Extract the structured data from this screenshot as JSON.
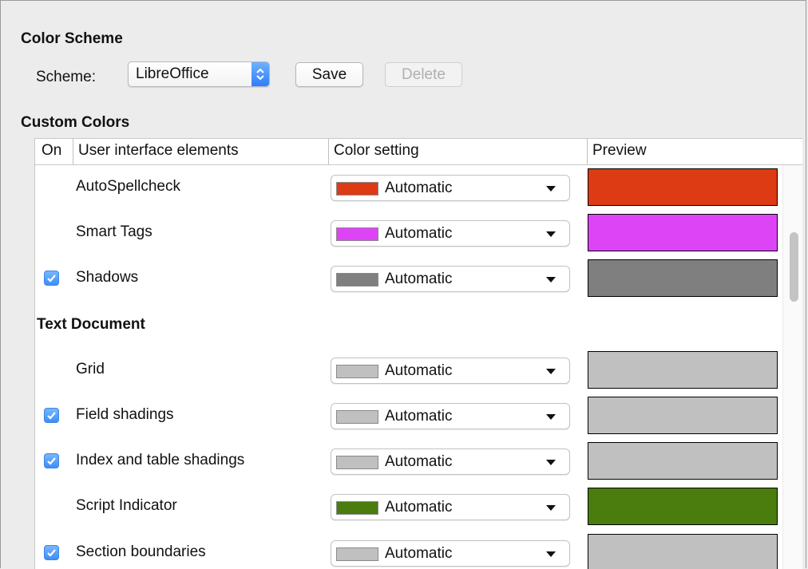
{
  "color_scheme": {
    "title": "Color Scheme",
    "scheme_label": "Scheme:",
    "scheme_value": "LibreOffice",
    "save_label": "Save",
    "delete_label": "Delete"
  },
  "custom_colors": {
    "title": "Custom Colors",
    "headers": {
      "on": "On",
      "elements": "User interface elements",
      "color_setting": "Color setting",
      "preview": "Preview"
    },
    "rows": [
      {
        "type": "item",
        "label": "AutoSpellcheck",
        "checkbox": false,
        "checked": false,
        "setting": "Automatic",
        "color": "#dc3b14"
      },
      {
        "type": "item",
        "label": "Smart Tags",
        "checkbox": false,
        "checked": false,
        "setting": "Automatic",
        "color": "#dd44f5"
      },
      {
        "type": "item",
        "label": "Shadows",
        "checkbox": true,
        "checked": true,
        "setting": "Automatic",
        "color": "#7f7f7f"
      },
      {
        "type": "group",
        "label": "Text Document"
      },
      {
        "type": "item",
        "label": "Grid",
        "checkbox": false,
        "checked": false,
        "setting": "Automatic",
        "color": "#c0c0c0"
      },
      {
        "type": "item",
        "label": "Field shadings",
        "checkbox": true,
        "checked": true,
        "setting": "Automatic",
        "color": "#c0c0c0"
      },
      {
        "type": "item",
        "label": "Index and table shadings",
        "checkbox": true,
        "checked": true,
        "setting": "Automatic",
        "color": "#c0c0c0"
      },
      {
        "type": "item",
        "label": "Script Indicator",
        "checkbox": false,
        "checked": false,
        "setting": "Automatic",
        "color": "#4a7c0e"
      },
      {
        "type": "item",
        "label": "Section boundaries",
        "checkbox": true,
        "checked": true,
        "setting": "Automatic",
        "color": "#c0c0c0"
      }
    ]
  },
  "icons": {
    "stepper": "up-down-stepper-icon",
    "checkmark": "checkmark-icon",
    "dropdown": "dropdown-arrow-icon"
  }
}
